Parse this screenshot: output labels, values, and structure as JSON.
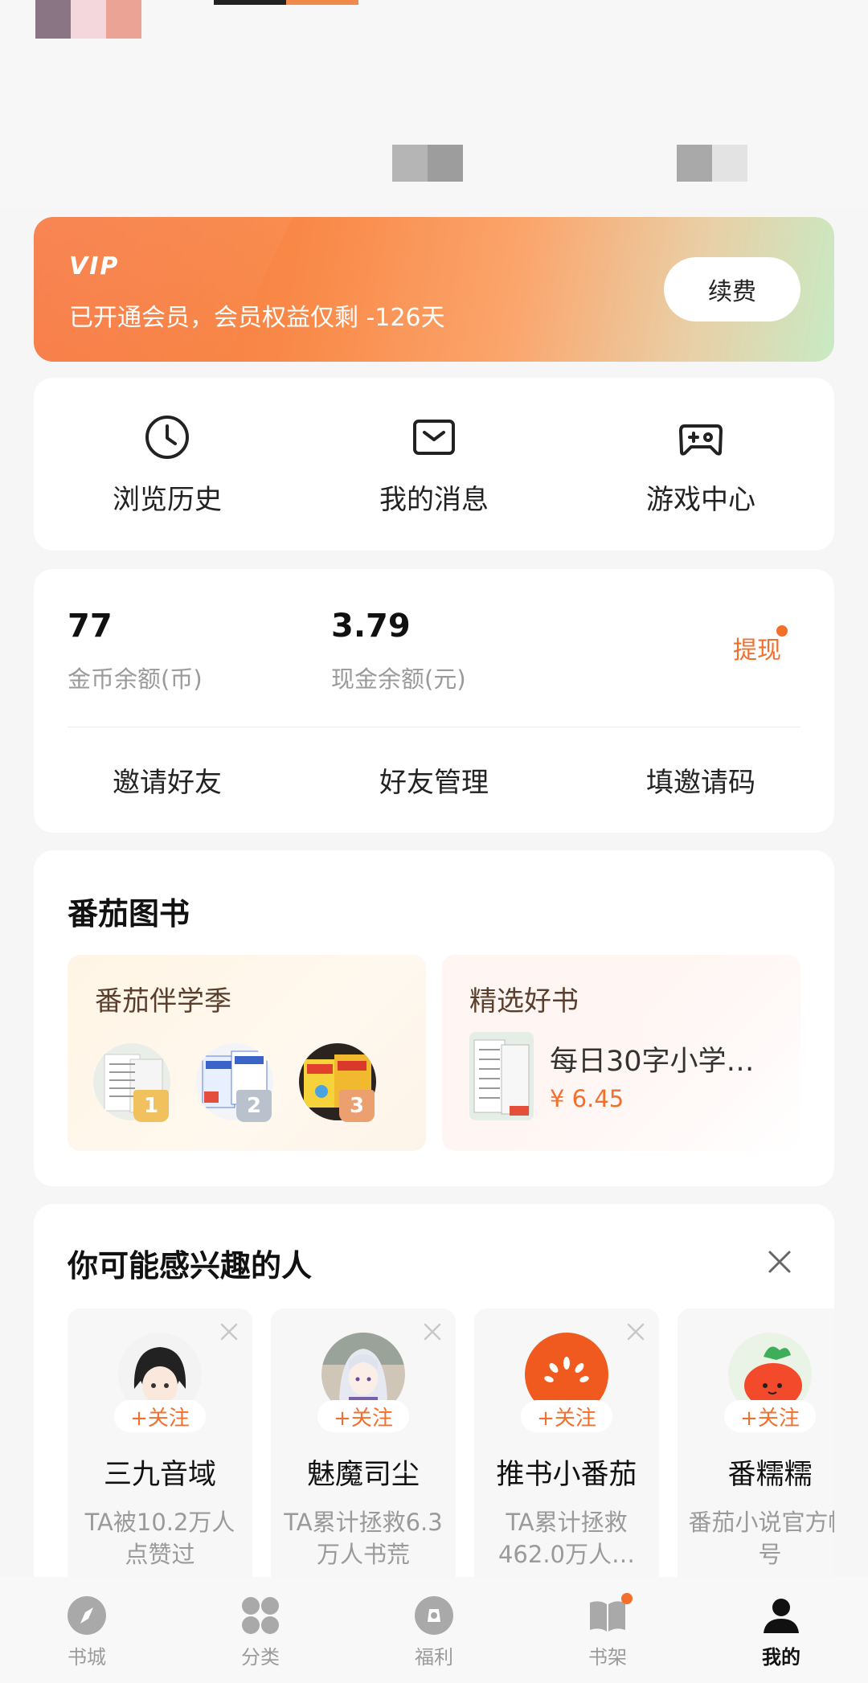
{
  "vip": {
    "logo": "VIP",
    "status_text": "已开通会员，会员权益仅剩 -126天",
    "renew_label": "续费"
  },
  "quick_actions": [
    {
      "label": "浏览历史",
      "icon": "clock-icon"
    },
    {
      "label": "我的消息",
      "icon": "mail-icon"
    },
    {
      "label": "游戏中心",
      "icon": "gamepad-icon"
    }
  ],
  "wallet": {
    "coins_value": "77",
    "coins_caption": "金币余额(币)",
    "cash_value": "3.79",
    "cash_caption": "现金余额(元)",
    "withdraw_label": "提现",
    "links": [
      "邀请好友",
      "好友管理",
      "填邀请码"
    ]
  },
  "books": {
    "title": "番茄图书",
    "left_panel_title": "番茄伴学季",
    "ranks": [
      "1",
      "2",
      "3"
    ],
    "right_panel_title": "精选好书",
    "featured_name": "每日30字小学…",
    "featured_price": "¥ 6.45"
  },
  "people": {
    "title": "你可能感兴趣的人",
    "follow_label": "+关注",
    "items": [
      {
        "name": "三九音域",
        "desc": "TA被10.2万人点赞过"
      },
      {
        "name": "魅魔司尘",
        "desc": "TA累计拯救6.3万人书荒"
      },
      {
        "name": "推书小番茄",
        "desc": "TA累计拯救462.0万人…"
      },
      {
        "name": "番糯糯",
        "desc": "番茄小说官方帐号"
      }
    ]
  },
  "nav": [
    {
      "label": "书城",
      "icon": "compass-icon"
    },
    {
      "label": "分类",
      "icon": "grid-icon"
    },
    {
      "label": "福利",
      "icon": "gift-icon"
    },
    {
      "label": "书架",
      "icon": "book-icon"
    },
    {
      "label": "我的",
      "icon": "user-icon"
    }
  ],
  "colors": {
    "accent": "#f26f2c",
    "vip_start": "#f7733a",
    "vip_end": "#c8eac4"
  }
}
